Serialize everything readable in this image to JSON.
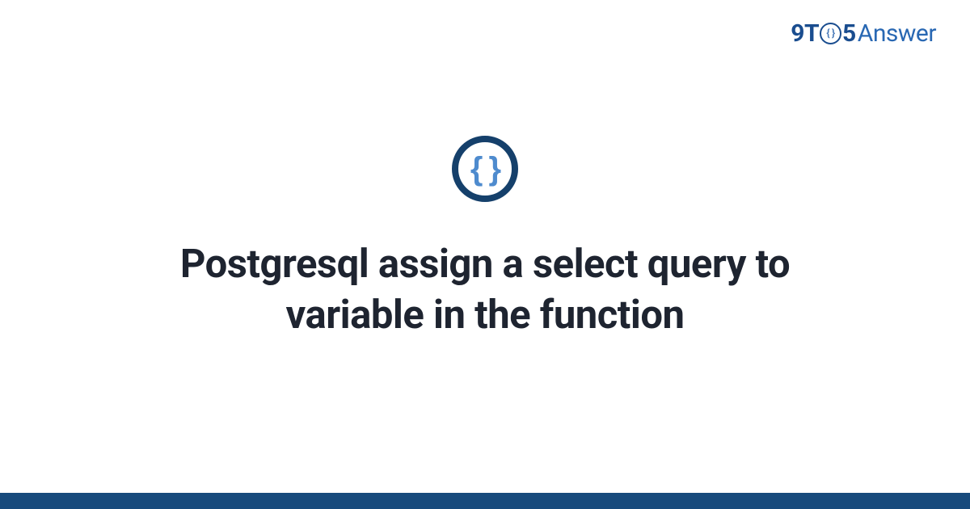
{
  "logo": {
    "nine": "9",
    "t": "T",
    "circle": "{ }",
    "five": "5",
    "answer": "Answer"
  },
  "icon": {
    "braces": "{ }"
  },
  "title": "Postgresql assign a select query to variable in the function"
}
